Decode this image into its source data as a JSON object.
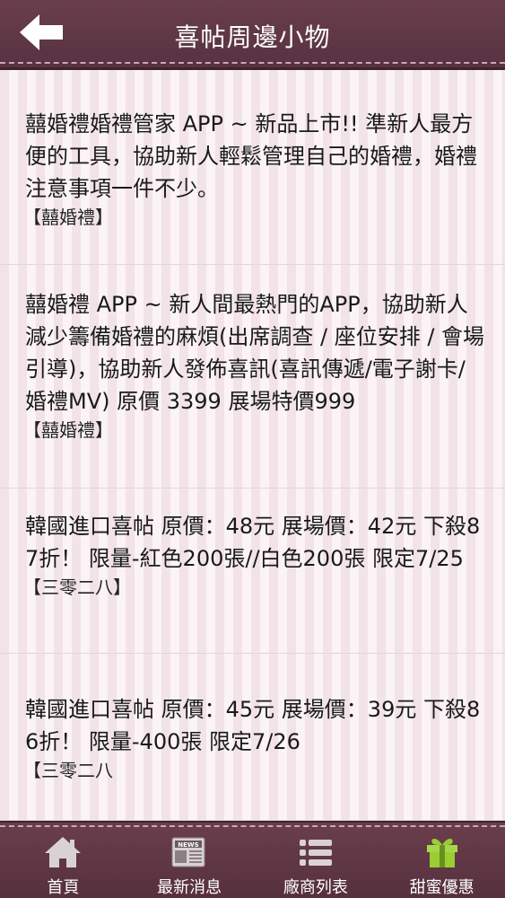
{
  "header": {
    "title": "喜帖周邊小物",
    "back_icon": "arrow-left-icon"
  },
  "items": [
    {
      "text": "囍婚禮婚禮管家 APP ~ 新品上市!! 準新人最方便的工具，協助新人輕鬆管理自己的婚禮，婚禮注意事項一件不少。",
      "source": "【囍婚禮】"
    },
    {
      "text": "囍婚禮 APP ~ 新人間最熱門的APP，協助新人減少籌備婚禮的麻煩(出席調查 / 座位安排 / 會場引導)，協助新人發佈喜訊(喜訊傳遞/電子謝卡/婚禮MV) 原價 3399 展場特價999",
      "source": "【囍婚禮】"
    },
    {
      "text": "韓國進口喜帖 原價：48元  展場價：42元 下殺87折！  限量-紅色200張//白色200張 限定7/25",
      "source": "【三零二八】"
    },
    {
      "text": "韓國進口喜帖 原價：45元 展場價：39元 下殺86折！  限量-400張 限定7/26",
      "source": "【三零二八"
    }
  ],
  "tabbar": {
    "tabs": [
      {
        "label": "首頁",
        "icon": "home-icon"
      },
      {
        "label": "最新消息",
        "icon": "news-icon"
      },
      {
        "label": "廠商列表",
        "icon": "list-icon"
      },
      {
        "label": "甜蜜優惠",
        "icon": "gift-icon"
      }
    ]
  },
  "colors": {
    "bar": "#5e3645",
    "background": "#fbf3f6",
    "stitch": "#c9a8b5",
    "gift_green": "#9acd32"
  }
}
